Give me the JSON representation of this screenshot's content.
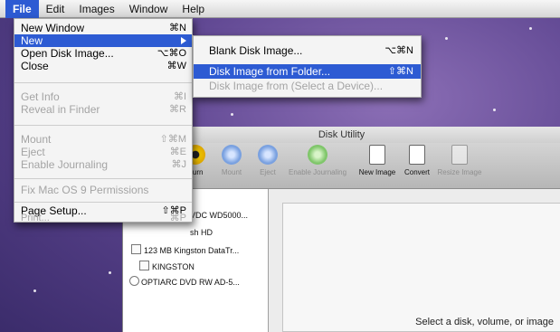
{
  "menubar": {
    "items": [
      "File",
      "Edit",
      "Images",
      "Window",
      "Help"
    ]
  },
  "file_menu": {
    "items": [
      {
        "label": "New Window",
        "shortcut": "⌘N",
        "disabled": false
      },
      {
        "label": "New",
        "shortcut": "",
        "disabled": false,
        "highlighted": true,
        "submenu": true
      },
      {
        "label": "Open Disk Image...",
        "shortcut": "⌥⌘O",
        "disabled": false
      },
      {
        "label": "Close",
        "shortcut": "⌘W",
        "disabled": false
      },
      {
        "label": "Get Info",
        "shortcut": "⌘I",
        "disabled": true
      },
      {
        "label": "Reveal in Finder",
        "shortcut": "⌘R",
        "disabled": true
      },
      {
        "label": "Mount",
        "shortcut": "⇧⌘M",
        "disabled": true
      },
      {
        "label": "Eject",
        "shortcut": "⌘E",
        "disabled": true
      },
      {
        "label": "Enable Journaling",
        "shortcut": "⌘J",
        "disabled": true
      },
      {
        "label": "Fix Mac OS 9 Permissions",
        "shortcut": "",
        "disabled": true
      },
      {
        "label": "Page Setup...",
        "shortcut": "⇧⌘P",
        "disabled": false
      },
      {
        "label": "Print...",
        "shortcut": "⌘P",
        "disabled": true
      }
    ]
  },
  "new_submenu": {
    "items": [
      {
        "label": "Blank Disk Image...",
        "shortcut": "⌥⌘N",
        "disabled": false
      },
      {
        "label": "Disk Image from Folder...",
        "shortcut": "⇧⌘N",
        "disabled": false,
        "highlighted": true
      },
      {
        "label": "Disk Image from (Select a Device)...",
        "shortcut": "",
        "disabled": true
      }
    ]
  },
  "window": {
    "title": "Disk Utility",
    "toolbar": [
      {
        "label": "Burn",
        "icon": "burn-icon",
        "enabled": true
      },
      {
        "label": "Mount",
        "icon": "mount-icon",
        "enabled": false
      },
      {
        "label": "Eject",
        "icon": "eject-icon",
        "enabled": false
      },
      {
        "label": "Enable Journaling",
        "icon": "journaling-icon",
        "enabled": false
      },
      {
        "label": "New Image",
        "icon": "new-image-icon",
        "enabled": true
      },
      {
        "label": "Convert",
        "icon": "convert-icon",
        "enabled": true
      },
      {
        "label": "Resize Image",
        "icon": "resize-image-icon",
        "enabled": false
      }
    ],
    "sidebar": [
      {
        "label": "VDC WD5000..."
      },
      {
        "label": "sh HD"
      },
      {
        "label": "123 MB Kingston DataTr..."
      },
      {
        "label": "KINGSTON"
      },
      {
        "label": "OPTIARC DVD RW AD-5..."
      }
    ],
    "detail_message": "Select a disk, volume, or image"
  },
  "colors": {
    "highlight": "#2d5bd3",
    "desktop": "#5d4590"
  }
}
